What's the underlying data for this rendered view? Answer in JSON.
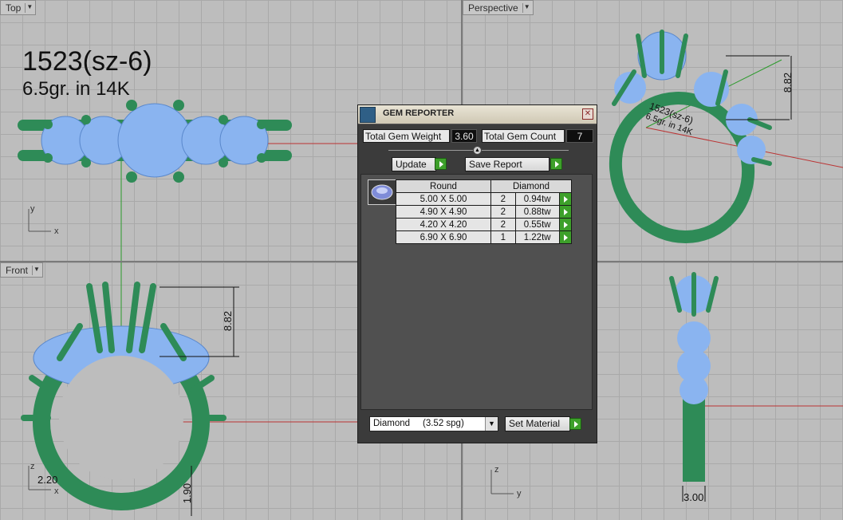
{
  "viewports": {
    "top": {
      "label": "Top",
      "note_line1": "1523(sz-6)",
      "note_line2": "6.5gr.  in 14K",
      "axis_y": "y",
      "axis_x": "x"
    },
    "perspective": {
      "label": "Perspective",
      "dim_height": "8.82",
      "annot_line1": "1523(sz-6)",
      "annot_line2": "6.5gr.  in 14K"
    },
    "front": {
      "label": "Front",
      "dim_height": "8.82",
      "dim_left": "2.20",
      "dim_bottom": "1.90",
      "axis_z": "z",
      "axis_x": "x"
    },
    "right": {
      "dim_bottom": "3.00",
      "axis_z": "z",
      "axis_y": "y"
    }
  },
  "gem_reporter": {
    "title": "GEM REPORTER",
    "total_weight_label": "Total Gem Weight",
    "total_weight_value": "3.60",
    "total_count_label": "Total Gem Count",
    "total_count_value": "7",
    "update_label": "Update",
    "save_report_label": "Save Report",
    "table": {
      "shape_header": "Round",
      "type_header": "Diamond",
      "rows": [
        {
          "size": "5.00 X 5.00",
          "qty": "2",
          "tw": "0.94tw"
        },
        {
          "size": "4.90 X 4.90",
          "qty": "2",
          "tw": "0.88tw"
        },
        {
          "size": "4.20 X 4.20",
          "qty": "2",
          "tw": "0.55tw"
        },
        {
          "size": "6.90 X 6.90",
          "qty": "1",
          "tw": "1.22tw"
        }
      ]
    },
    "material_value": "Diamond     (3.52 spg)",
    "set_material_label": "Set Material"
  },
  "colors": {
    "metal": "#2e8b57",
    "gem": "#8ab4f0",
    "viewport_bg": "#bdbdbd",
    "panel_bg": "#3b3b3b"
  }
}
